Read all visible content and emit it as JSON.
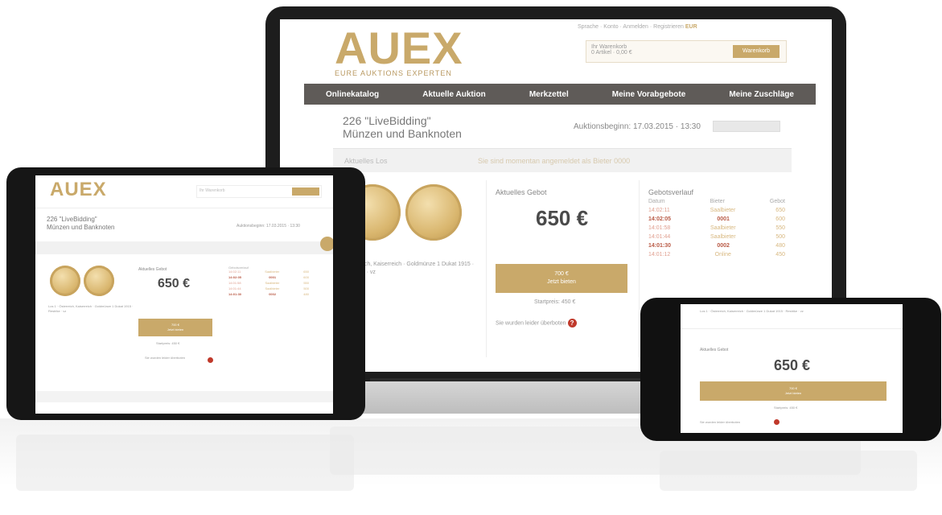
{
  "brand": {
    "logo": "AUEX",
    "tagline": "EURE AUKTIONS EXPERTEN",
    "accent": "#c9a96a",
    "nav_color": "#5f5b58"
  },
  "laptop": {
    "topbar": "Sprache · Konto · Anmelden · Registrieren",
    "topbar_cart": "EUR",
    "cart_label": "Ihr Warenkorb",
    "cart_info": "0 Artikel · 0,00 €",
    "cart_button": "Warenkorb",
    "nav": [
      "Onlinekatalog",
      "Aktuelle Auktion",
      "Merkzettel",
      "Meine Vorabgebote",
      "Meine Zuschläge"
    ],
    "auction_title": "226 \"LiveBidding\"",
    "auction_subtitle": "Münzen und Banknoten",
    "auction_end": "Auktionsbeginn: 17.03.2015 · 13:30",
    "banner_left": "Aktuelles Los",
    "banner_mid": "Sie sind momentan angemeldet als Bieter 0000",
    "lot_desc_title": "Los 1",
    "lot_desc": "Österreich, Kaiserreich · Goldmünze 1 Dukat 1915 · Restrike · vz",
    "current_bid_label": "Aktuelles Gebot",
    "price": "650 €",
    "bid_button_line1": "700 €",
    "bid_button_line2": "Jetzt bieten",
    "start_price": "Startpreis: 450 €",
    "help_text": "Sie wurden leider überboten",
    "help_icon": "?",
    "history_title": "Gebotsverlauf",
    "history_headers": [
      "Datum",
      "Bieter",
      "Gebot"
    ],
    "history_rows": [
      [
        "14:02:11",
        "Saalbieter",
        "650"
      ],
      [
        "14:02:05",
        "0001",
        "600"
      ],
      [
        "14:01:58",
        "Saalbieter",
        "550"
      ],
      [
        "14:01:44",
        "Saalbieter",
        "500"
      ],
      [
        "14:01:30",
        "0002",
        "480"
      ],
      [
        "14:01:12",
        "Online",
        "450"
      ]
    ]
  },
  "tablet": {
    "auction_title": "226 \"LiveBidding\"",
    "auction_subtitle": "Münzen und Banknoten",
    "auction_end": "Auktionsbeginn: 17.03.2015 · 13:30",
    "current_bid_label": "Aktuelles Gebot",
    "price": "650 €",
    "bid_button_line1": "700 €",
    "bid_button_line2": "Jetzt bieten",
    "start_price": "Startpreis: 450 €",
    "help_text": "Sie wurden leider überboten"
  },
  "phone": {
    "lot_desc": "Los 1 · Österreich, Kaiserreich · Goldmünze 1 Dukat 1915 · Restrike · vz",
    "current_bid_label": "Aktuelles Gebot",
    "price": "650 €",
    "bid_button_line1": "700 €",
    "bid_button_line2": "Jetzt bieten",
    "start_price": "Startpreis: 450 €",
    "help_text": "Sie wurden leider überboten"
  }
}
